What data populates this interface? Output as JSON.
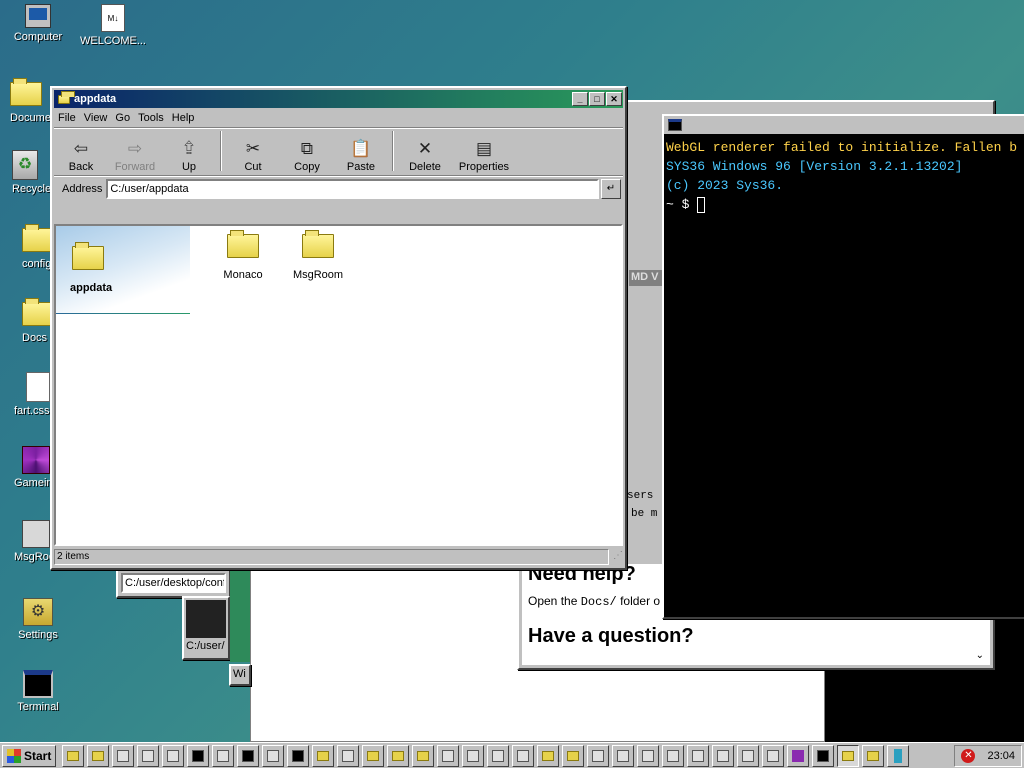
{
  "desktop_icons": [
    {
      "label": "Computer",
      "icon": "computer-icon"
    },
    {
      "label": "WELCOME...",
      "icon": "markdown-file-icon"
    },
    {
      "label": "Docume",
      "icon": "folder-icon"
    },
    {
      "label": "Recycle",
      "icon": "recycle-bin-icon"
    },
    {
      "label": "config",
      "icon": "folder-icon"
    },
    {
      "label": "Docs",
      "icon": "folder-icon"
    },
    {
      "label": "fart.css",
      "icon": "file-icon"
    },
    {
      "label": "Gamein",
      "icon": "game-icon"
    },
    {
      "label": "MsgRoo",
      "icon": "msgroom-icon"
    },
    {
      "label": "Settings",
      "icon": "settings-icon"
    },
    {
      "label": "Terminal",
      "icon": "terminal-icon"
    }
  ],
  "explorer": {
    "title": "appdata",
    "menu": [
      "File",
      "View",
      "Go",
      "Tools",
      "Help"
    ],
    "toolbar": {
      "back": "Back",
      "forward": "Forward",
      "up": "Up",
      "cut": "Cut",
      "copy": "Copy",
      "paste": "Paste",
      "delete": "Delete",
      "properties": "Properties"
    },
    "address_label": "Address",
    "address_value": "C:/user/appdata",
    "sidebar_title": "appdata",
    "items": [
      {
        "name": "Monaco"
      },
      {
        "name": "MsgRoom"
      }
    ],
    "status": "2 items"
  },
  "terminal": {
    "lines": [
      "WebGL renderer failed to initialize. Fallen b",
      "SYS36 Windows 96 [Version 3.2.1.13202]",
      "(c) 2023 Sys36.",
      "",
      "~ $ "
    ]
  },
  "help_window": {
    "need_help": "Need help?",
    "docs_text_pre": "Open the ",
    "docs_code": "Docs/",
    "docs_text_post": " folder o",
    "have_question": "Have a question?",
    "side_text_1": "sers",
    "side_text_2": "be m",
    "md_tab": "MD V"
  },
  "bg_windows": {
    "path1": "C:/user/desktop/conf",
    "path2": "C:/user/",
    "win_label": "Wi"
  },
  "taskbar": {
    "start": "Start",
    "clock": "23:04"
  }
}
